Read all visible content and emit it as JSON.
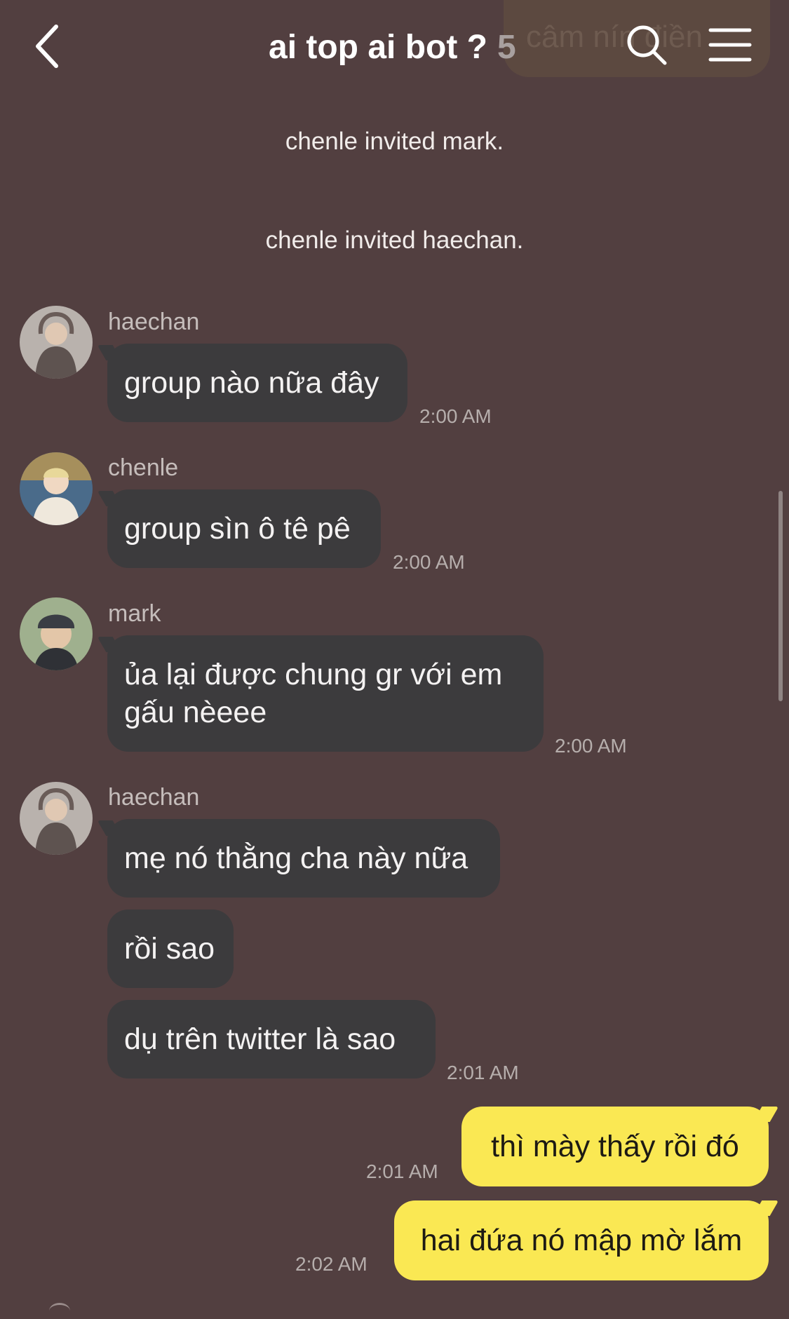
{
  "header": {
    "title": "ai top ai bot ?",
    "member_count": "5",
    "ghost_text": "câm nín điền",
    "back_icon": "chevron-left-icon",
    "search_icon": "search-icon",
    "menu_icon": "hamburger-menu-icon"
  },
  "system_messages": [
    "chenle invited mark.",
    "chenle invited haechan."
  ],
  "messages": [
    {
      "sender": "haechan",
      "texts": [
        "group nào nữa đây"
      ],
      "time": "2:00 AM"
    },
    {
      "sender": "chenle",
      "texts": [
        "group sìn ô tê pê"
      ],
      "time": "2:00 AM"
    },
    {
      "sender": "mark",
      "texts": [
        "ủa lại được chung gr với em gấu nèeee"
      ],
      "time": "2:00 AM"
    },
    {
      "sender": "haechan",
      "texts": [
        "mẹ nó thằng cha này nữa",
        "rồi sao",
        "dụ trên twitter là sao"
      ],
      "time": "2:01 AM"
    }
  ],
  "my_messages": [
    {
      "text": "thì mày thấy rồi đó",
      "time": "2:01 AM"
    },
    {
      "text": "hai đứa nó mập mờ lắm",
      "time": "2:02 AM"
    }
  ],
  "colors": {
    "background": "#523f40",
    "incoming_bubble": "#3c3b3d",
    "outgoing_bubble": "#fae853"
  }
}
